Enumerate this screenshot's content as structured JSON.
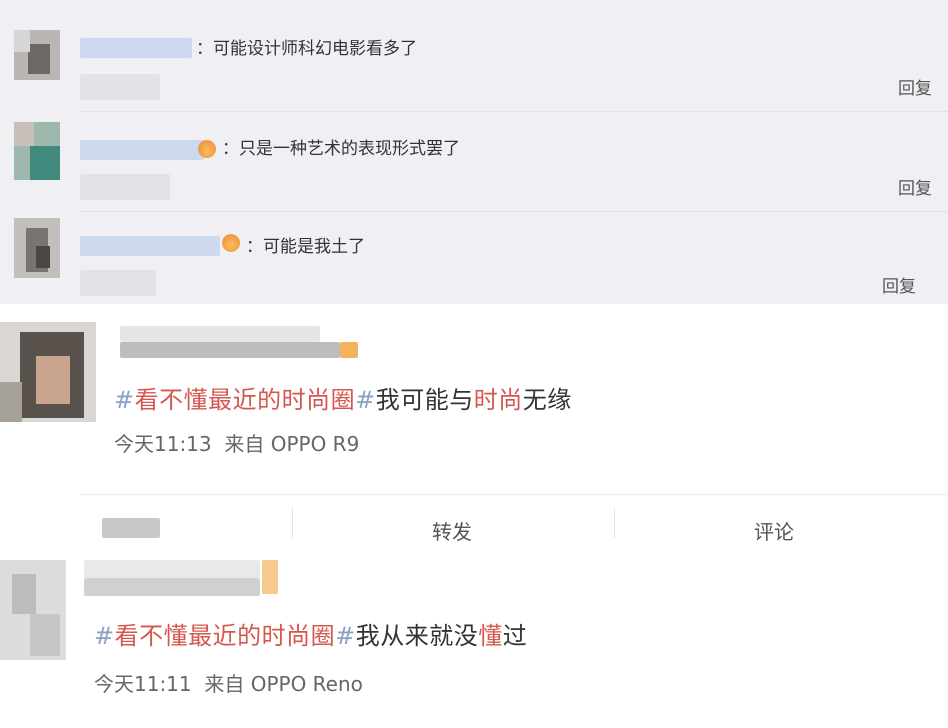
{
  "replies": [
    {
      "text": "：可能设计师科幻电影看多了",
      "reply_label": "回复"
    },
    {
      "text": "：只是一种艺术的表现形式罢了",
      "reply_label": "回复"
    },
    {
      "text": "：可能是我土了",
      "reply_label": "回复"
    }
  ],
  "post1": {
    "hash_open": "#",
    "topic": "看不懂最近的时尚圈",
    "hash_close": "#",
    "body_a": "我可能与",
    "body_hl": "时尚",
    "body_b": "无缘",
    "time": "今天11:13",
    "source": "来自 OPPO R9"
  },
  "actions": {
    "repost": "转发",
    "comment": "评论"
  },
  "post2": {
    "hash_open": "#",
    "topic": "看不懂最近的时尚圈",
    "hash_close": "#",
    "body_a": "我从来就没",
    "body_hl": "懂",
    "body_b": "过",
    "time": "今天11:11",
    "source": "来自 OPPO Reno"
  },
  "colors": {
    "topic": "#d4584f",
    "hashtag": "#8aa1c6",
    "reply_bg": "#f0f0f4"
  },
  "icons": [
    "crown-badge-icon"
  ]
}
